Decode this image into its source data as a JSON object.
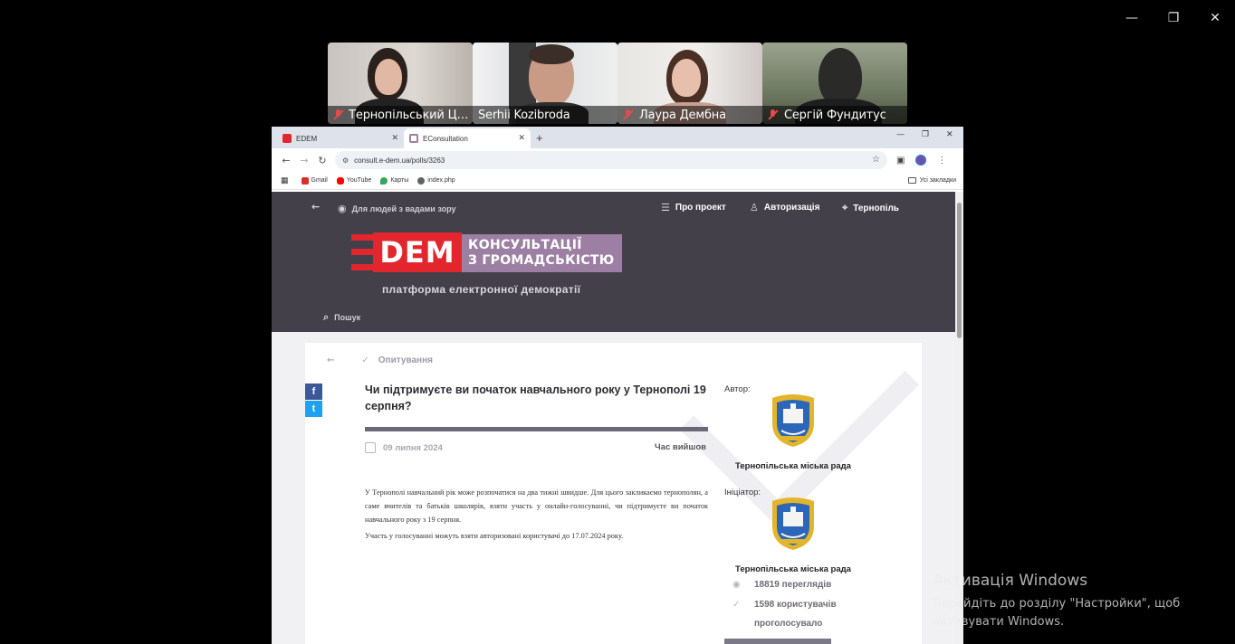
{
  "window_controls": {
    "minimize": "—",
    "restore": "❐",
    "close": "✕"
  },
  "participants": [
    {
      "name": "Тернопільський Цен...",
      "muted": true,
      "active": false
    },
    {
      "name": "Serhii Kozibroda",
      "muted": false,
      "active": true
    },
    {
      "name": "Лаура Дембна",
      "muted": true,
      "active": false
    },
    {
      "name": "Сергій Фундитус",
      "muted": true,
      "active": false
    }
  ],
  "browser": {
    "tabs": [
      {
        "title": "EDEM",
        "close": "✕",
        "active": false
      },
      {
        "title": "EConsultation",
        "close": "✕",
        "active": true
      }
    ],
    "new_tab": "+",
    "controls": {
      "minimize": "—",
      "restore": "❐",
      "close": "✕"
    },
    "nav": {
      "back": "←",
      "forward": "→",
      "reload": "↻"
    },
    "url": "consult.e-dem.ua/polls/3263",
    "bookmarks": [
      {
        "label": "Gmail",
        "color": "#d93025"
      },
      {
        "label": "YouTube",
        "color": "#ff0000"
      },
      {
        "label": "Карты",
        "color": "#34a853"
      },
      {
        "label": "index.php",
        "color": "#5f6368"
      }
    ],
    "all_bookmarks": "Усі закладки"
  },
  "site": {
    "back_arrow": "←",
    "accessibility": "Для людей з вадами зору",
    "menu": {
      "about": "Про проект",
      "auth": "Авторизація",
      "city": "Тернопіль"
    },
    "logo": {
      "dem": "DEM",
      "line1": "КОНСУЛЬТАЦІЇ",
      "line2": "З ГРОМАДСЬКІСТЮ"
    },
    "platform": "платформа електронної демократії",
    "search": "Пошук"
  },
  "poll": {
    "breadcrumb": "Опитування",
    "title": "Чи підтримуєте ви початок навчального року у Тернополі 19 серпня?",
    "date": "09 липня 2024",
    "status": "Час вийшов",
    "description": "У Тернополі навчальний рік може розпочатися на два тижні швидше. Для цього закликаємо тернополян, а саме вчителів та батьків школярів, взяти участь у онлайн-голосуванні, чи підтримуєте ви початок навчального року з 19 серпня.",
    "participation": "Участь у голосуванні можуть взяти авторизовані користувачі до 17.07.2024 року.",
    "author_label": "Автор:",
    "author": "Тернопільська міська рада",
    "initiator_label": "Ініціатор:",
    "initiator": "Тернопільська міська рада",
    "views": "18819 переглядів",
    "voted_line1": "1598 користувачів",
    "voted_line2": "проголосувало",
    "share": {
      "facebook": "f",
      "twitter": "t"
    }
  },
  "activation": {
    "title": "Активація Windows",
    "line1": "Перейдіть до розділу \"Настройки\", щоб",
    "line2": "активувати Windows."
  }
}
